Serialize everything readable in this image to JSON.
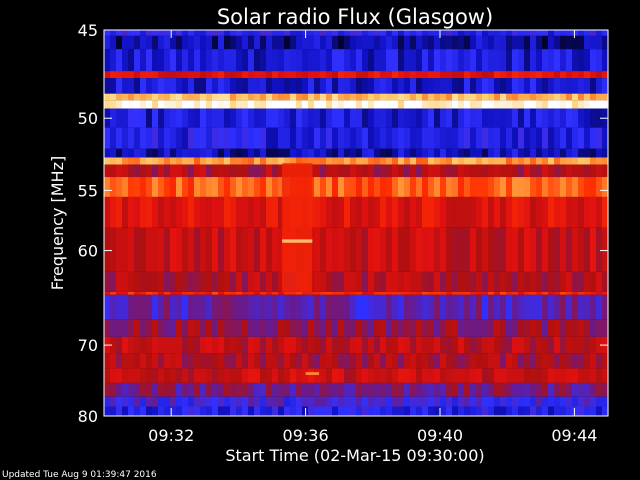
{
  "chart_data": {
    "type": "heatmap",
    "title": "Solar radio Flux (Glasgow)",
    "xlabel": "Start Time (02-Mar-15 09:30:00)",
    "ylabel": "Frequency [MHz]",
    "x_unit": "minutes",
    "xlim": [
      0,
      15
    ],
    "ylim": [
      80,
      45
    ],
    "x_ticks": [
      {
        "value": 2,
        "label": "09:32"
      },
      {
        "value": 6,
        "label": "09:36"
      },
      {
        "value": 10,
        "label": "09:40"
      },
      {
        "value": 14,
        "label": "09:44"
      }
    ],
    "y_ticks": [
      {
        "value": 45,
        "label": "45"
      },
      {
        "value": 50,
        "label": "50"
      },
      {
        "value": 55,
        "label": "55"
      },
      {
        "value": 60,
        "label": "60"
      },
      {
        "value": 70,
        "label": "70"
      },
      {
        "value": 80,
        "label": "80"
      }
    ],
    "colormap": [
      "#000010",
      "#1010c0",
      "#3030ff",
      "#6a1a8a",
      "#b01010",
      "#e01010",
      "#ff3000",
      "#ff8a30",
      "#ffd070",
      "#ffffff"
    ],
    "frequency_bands": [
      {
        "from": 45.0,
        "to": 45.3,
        "level": 0.2
      },
      {
        "from": 45.3,
        "to": 46.0,
        "level": 0.1
      },
      {
        "from": 46.0,
        "to": 47.2,
        "level": 0.15
      },
      {
        "from": 47.2,
        "to": 47.6,
        "level": 0.55
      },
      {
        "from": 47.6,
        "to": 48.5,
        "level": 0.15
      },
      {
        "from": 48.5,
        "to": 48.9,
        "level": 0.85
      },
      {
        "from": 48.9,
        "to": 49.4,
        "level": 0.98
      },
      {
        "from": 49.4,
        "to": 50.6,
        "level": 0.15
      },
      {
        "from": 50.6,
        "to": 52.0,
        "level": 0.18
      },
      {
        "from": 52.0,
        "to": 52.6,
        "level": 0.12
      },
      {
        "from": 52.6,
        "to": 53.1,
        "level": 0.8
      },
      {
        "from": 53.1,
        "to": 54.0,
        "level": 0.45
      },
      {
        "from": 54.0,
        "to": 55.5,
        "level": 0.72
      },
      {
        "from": 55.5,
        "to": 58.0,
        "level": 0.55
      },
      {
        "from": 58.0,
        "to": 62.0,
        "level": 0.5
      },
      {
        "from": 62.0,
        "to": 64.0,
        "level": 0.45
      },
      {
        "from": 64.0,
        "to": 64.3,
        "level": 0.62
      },
      {
        "from": 64.3,
        "to": 67.0,
        "level": 0.3
      },
      {
        "from": 67.0,
        "to": 69.0,
        "level": 0.4
      },
      {
        "from": 69.0,
        "to": 71.0,
        "level": 0.48
      },
      {
        "from": 71.0,
        "to": 73.0,
        "level": 0.44
      },
      {
        "from": 73.0,
        "to": 75.0,
        "level": 0.5
      },
      {
        "from": 75.0,
        "to": 77.0,
        "level": 0.35
      },
      {
        "from": 77.0,
        "to": 78.5,
        "level": 0.25
      },
      {
        "from": 78.5,
        "to": 80.0,
        "level": 0.18
      }
    ],
    "events": [
      {
        "t_start": 5.3,
        "t_end": 6.2,
        "f_from": 53.0,
        "f_to": 64.0,
        "level": 0.62
      },
      {
        "t_start": 5.3,
        "t_end": 6.2,
        "f_from": 59.0,
        "f_to": 59.3,
        "level": 0.9
      },
      {
        "t_start": 6.0,
        "t_end": 6.4,
        "f_from": 73.5,
        "f_to": 73.9,
        "level": 0.8
      }
    ]
  },
  "footer": {
    "updated_text": "Updated Tue Aug  9 01:39:47 2016"
  }
}
